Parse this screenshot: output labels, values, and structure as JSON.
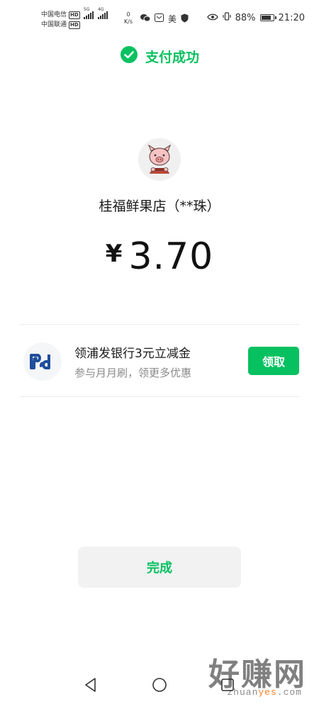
{
  "status_bar": {
    "carrier_1": "中国电信",
    "carrier_2": "中国联通",
    "hd": "HD",
    "net_5g": "5G",
    "net_4g": "4G",
    "net_speed_value": "0",
    "net_speed_unit": "K/s",
    "app_label": "美",
    "battery_percent": "88%",
    "battery_level": 0.88,
    "time": "21:20"
  },
  "header": {
    "title": "支付成功"
  },
  "merchant": {
    "name": "桂福鲜果店（**珠）"
  },
  "payment": {
    "currency": "¥",
    "amount": "3.70"
  },
  "promo": {
    "title": "领浦发银行3元立减金",
    "subtitle": "参与月月刷，领更多优惠",
    "button_label": "领取"
  },
  "actions": {
    "done_label": "完成"
  },
  "watermark": {
    "text_big": "好赚网",
    "text_small_1": "zhuan",
    "text_small_2": "yes",
    "text_small_3": ".com"
  },
  "colors": {
    "accent": "#07c160",
    "bank_blue": "#1f4e9c"
  }
}
